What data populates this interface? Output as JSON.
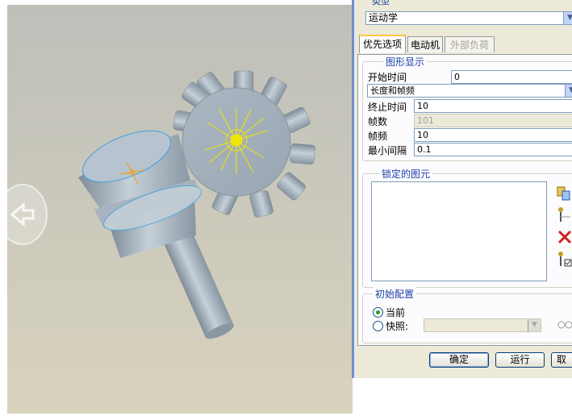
{
  "dialog": {
    "type_label": "类型",
    "type_value": "运动学",
    "tabs": [
      {
        "label": "优先选项",
        "state": "active"
      },
      {
        "label": "电动机",
        "state": "normal"
      },
      {
        "label": "外部负荷",
        "state": "disabled"
      }
    ],
    "graph_display": {
      "title": "图形显示",
      "start_time_label": "开始时间",
      "start_time_value": "0",
      "mode_value": "长度和帧频",
      "end_time_label": "终止时间",
      "end_time_value": "10",
      "frames_label": "帧数",
      "frames_value": "101",
      "frame_rate_label": "帧频",
      "frame_rate_value": "10",
      "min_interval_label": "最小间隔",
      "min_interval_value": "0.1"
    },
    "locked_entities": {
      "title": "锁定的图元"
    },
    "initial_config": {
      "title": "初始配置",
      "current_label": "当前",
      "snapshot_label": "快照:",
      "selected": "current"
    },
    "buttons": {
      "ok": "确定",
      "run": "运行",
      "cancel": "取"
    }
  },
  "colors": {
    "dialog_bg": "#ece9d8",
    "accent_blue": "#1c3fa5",
    "model_gray": "#a9b6c1",
    "highlight_yellow": "#f2e600"
  }
}
